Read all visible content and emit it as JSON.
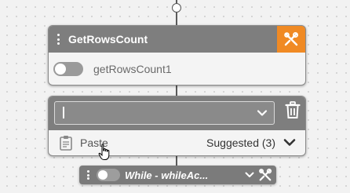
{
  "getrows_node": {
    "title": "GetRowsCount",
    "label": "getRowsCount1",
    "toggle_state": "off",
    "tools_icon": "tools-icon",
    "accent_color": "#f08a24"
  },
  "input_node": {
    "input_value": "",
    "paste_label": "Paste",
    "suggested_label": "Suggested (3)",
    "icons": [
      "chevron-down-icon",
      "trash-icon",
      "clipboard-icon",
      "chevron-down-icon"
    ]
  },
  "while_node": {
    "title": "While - whileAc...",
    "toggle_state": "off",
    "icons": [
      "chevron-down-icon",
      "tools-icon"
    ]
  }
}
